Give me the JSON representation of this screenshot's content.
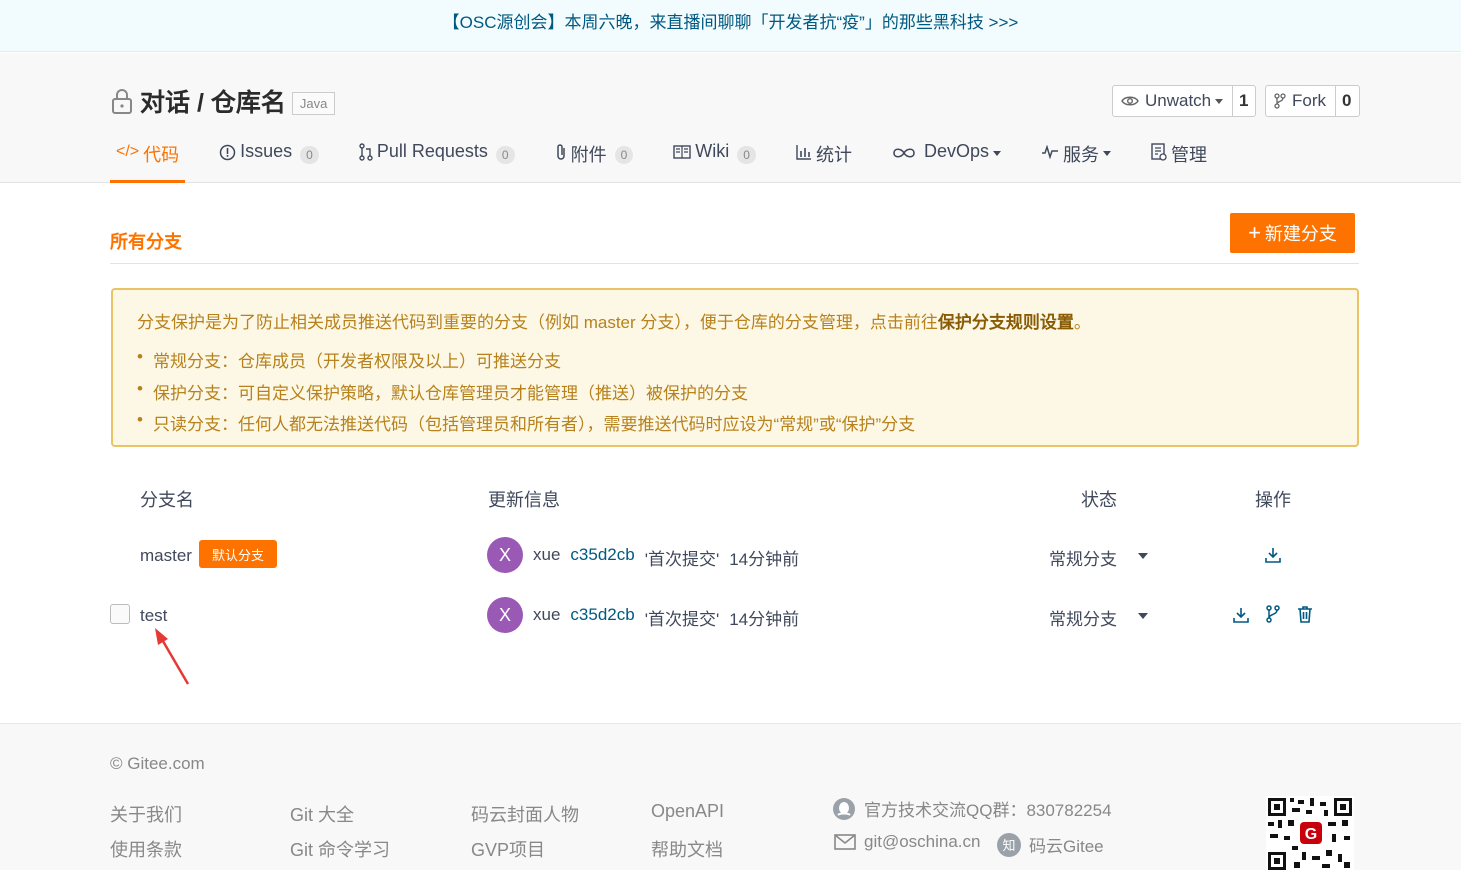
{
  "banner": {
    "text": "【OSC源创会】本周六晚，来直播间聊聊「开发者抗“疫”」的那些黑科技 >>>"
  },
  "repo": {
    "title": "对话 / 仓库名",
    "language": "Java"
  },
  "actions": {
    "watch_label": "Unwatch",
    "watch_count": "1",
    "fork_label": "Fork",
    "fork_count": "0"
  },
  "tabs": [
    {
      "label": "代码",
      "icon": "code-icon"
    },
    {
      "label": "Issues",
      "badge": "0",
      "icon": "issue-icon"
    },
    {
      "label": "Pull Requests",
      "badge": "0",
      "icon": "pull-request-icon"
    },
    {
      "label": "附件",
      "badge": "0",
      "icon": "paperclip-icon"
    },
    {
      "label": "Wiki",
      "badge": "0",
      "icon": "book-icon"
    },
    {
      "label": "统计",
      "icon": "bar-chart-icon"
    },
    {
      "label": "DevOps",
      "icon": "infinity-icon"
    },
    {
      "label": "服务",
      "icon": "pulse-icon"
    },
    {
      "label": "管理",
      "icon": "settings-doc-icon"
    }
  ],
  "branches_page": {
    "title": "所有分支",
    "new_branch_label": "新建分支",
    "notice": {
      "lead": "分支保护是为了防止相关成员推送代码到重要的分支（例如 master 分支），便于仓库的分支管理，点击前往",
      "lead_link": "保护分支规则设置",
      "lead_end": "。",
      "items": [
        "常规分支：仓库成员（开发者权限及以上）可推送分支",
        "保护分支：可自定义保护策略，默认仓库管理员才能管理（推送）被保护的分支",
        "只读分支：任何人都无法推送代码（包括管理员和所有者），需要推送代码时应设为“常规”或“保护”分支"
      ]
    },
    "columns": {
      "name": "分支名",
      "update": "更新信息",
      "status": "状态",
      "ops": "操作"
    },
    "rows": [
      {
        "name": "master",
        "default_badge": "默认分支",
        "avatar": "X",
        "author": "xue",
        "commit": "c35d2cb",
        "message": "'首次提交'",
        "time": "14分钟前",
        "status": "常规分支"
      },
      {
        "name": "test",
        "avatar": "X",
        "author": "xue",
        "commit": "c35d2cb",
        "message": "'首次提交'",
        "time": "14分钟前",
        "status": "常规分支"
      }
    ]
  },
  "footer": {
    "copyright": "© Gitee.com",
    "links": [
      "关于我们",
      "使用条款",
      "Git 大全",
      "Git 命令学习",
      "码云封面人物",
      "GVP项目",
      "OpenAPI",
      "帮助文档"
    ],
    "qq_group": "官方技术交流QQ群：830782254",
    "email": "git@oschina.cn",
    "zhihu": "码云Gitee"
  },
  "colors": {
    "accent": "#fe7300",
    "link": "#005980",
    "notice_bg": "#fdf8e6",
    "avatar": "#9b59b6"
  }
}
